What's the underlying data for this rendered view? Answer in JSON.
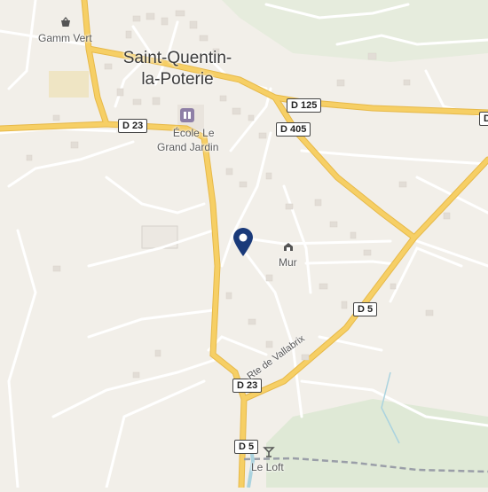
{
  "map": {
    "town_line1": "Saint-Quentin-",
    "town_line2": "la-Poterie",
    "places": {
      "gamm_vert": "Gamm Vert",
      "ecole_line1": "École Le",
      "ecole_line2": "Grand Jardin",
      "mur": "Mur",
      "le_loft": "Le Loft"
    },
    "road_shields": {
      "d23_top": "D 23",
      "d125": "D 125",
      "d405": "D 405",
      "d5_mid": "D 5",
      "d23_bottom": "D 23",
      "d5_bottom": "D 5",
      "d_right_edge": "D"
    },
    "road_names": {
      "rte_vallabrix": "Rte de Vallabrix"
    },
    "icons": [
      "shop-basket-icon",
      "school-icon",
      "monument-icon",
      "bar-glass-icon",
      "location-pin-icon"
    ],
    "colors": {
      "background": "#f2efe9",
      "major_road": "#f6cf65",
      "minor_road": "#ffffff",
      "green_area": "#dfe9d6",
      "water": "#aad3df",
      "pin": "#1a3a7a"
    }
  }
}
